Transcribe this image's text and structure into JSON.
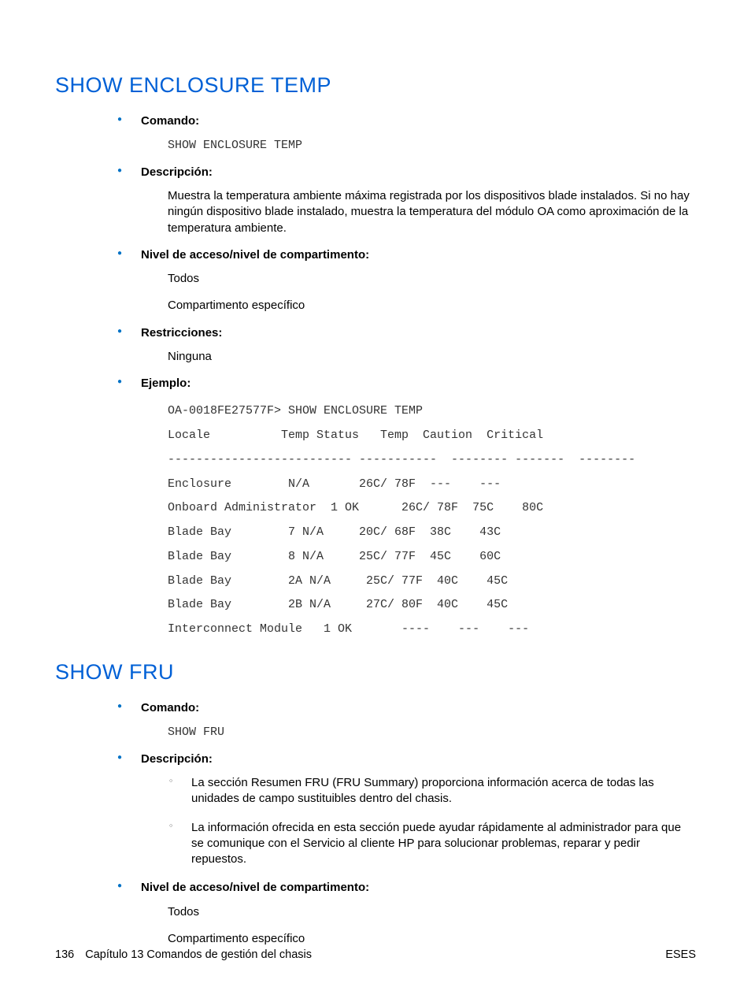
{
  "s1": {
    "heading": "SHOW ENCLOSURE TEMP",
    "comando_label": "Comando:",
    "comando_text": "SHOW ENCLOSURE TEMP",
    "descripcion_label": "Descripción:",
    "descripcion_text": "Muestra la temperatura ambiente máxima registrada por los dispositivos blade instalados. Si no hay ningún dispositivo blade instalado, muestra la temperatura del módulo OA como aproximación de la temperatura ambiente.",
    "nivel_label": "Nivel de acceso/nivel de compartimento:",
    "nivel_text1": "Todos",
    "nivel_text2": "Compartimento específico",
    "restr_label": "Restricciones:",
    "restr_text": "Ninguna",
    "ejemplo_label": "Ejemplo:",
    "ejemplo_block": "OA-0018FE27577F> SHOW ENCLOSURE TEMP\nLocale          Temp Status   Temp  Caution  Critical\n-------------------------- -----------  -------- -------  --------\nEnclosure        N/A       26C/ 78F  ---    ---\nOnboard Administrator  1 OK      26C/ 78F  75C    80C\nBlade Bay        7 N/A     20C/ 68F  38C    43C\nBlade Bay        8 N/A     25C/ 77F  45C    60C\nBlade Bay        2A N/A     25C/ 77F  40C    45C\nBlade Bay        2B N/A     27C/ 80F  40C    45C\nInterconnect Module   1 OK       ----    ---    ---"
  },
  "s2": {
    "heading": "SHOW FRU",
    "comando_label": "Comando:",
    "comando_text": "SHOW FRU",
    "descripcion_label": "Descripción:",
    "descripcion_sub1": "La sección Resumen FRU (FRU Summary) proporciona información acerca de todas las unidades de campo sustituibles dentro del chasis.",
    "descripcion_sub2": "La información ofrecida en esta sección puede ayudar rápidamente al administrador para que se comunique con el Servicio al cliente HP para solucionar problemas, reparar y pedir repuestos.",
    "nivel_label": "Nivel de acceso/nivel de compartimento:",
    "nivel_text1": "Todos",
    "nivel_text2": "Compartimento específico"
  },
  "footer": {
    "page": "136",
    "chapter": "Capítulo 13   Comandos de gestión del chasis",
    "right": "ESES"
  }
}
